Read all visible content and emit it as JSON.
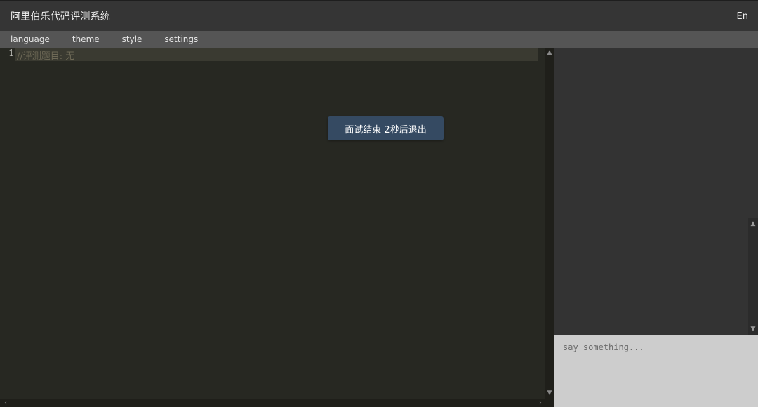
{
  "header": {
    "title": "阿里伯乐代码评测系统",
    "lang_toggle": "En"
  },
  "menu": {
    "items": [
      {
        "label": "language"
      },
      {
        "label": "theme"
      },
      {
        "label": "style"
      },
      {
        "label": "settings"
      }
    ]
  },
  "editor": {
    "line_number": "1",
    "code_line": "//评测题目: 无",
    "scroll_up_icon": "chevron-up-icon",
    "scroll_down_icon": "chevron-down-icon",
    "scroll_left_icon": "chevron-left-icon",
    "scroll_right_icon": "chevron-right-icon"
  },
  "toast": {
    "message": "面试结束 2秒后退出"
  },
  "chat": {
    "placeholder": "say something..."
  },
  "colors": {
    "titlebar_bg": "#353535",
    "menubar_bg": "#555555",
    "editor_bg": "#272822",
    "toast_bg": "#354a62",
    "panel_bg": "#333333",
    "chat_input_bg": "#cdcdcd"
  }
}
